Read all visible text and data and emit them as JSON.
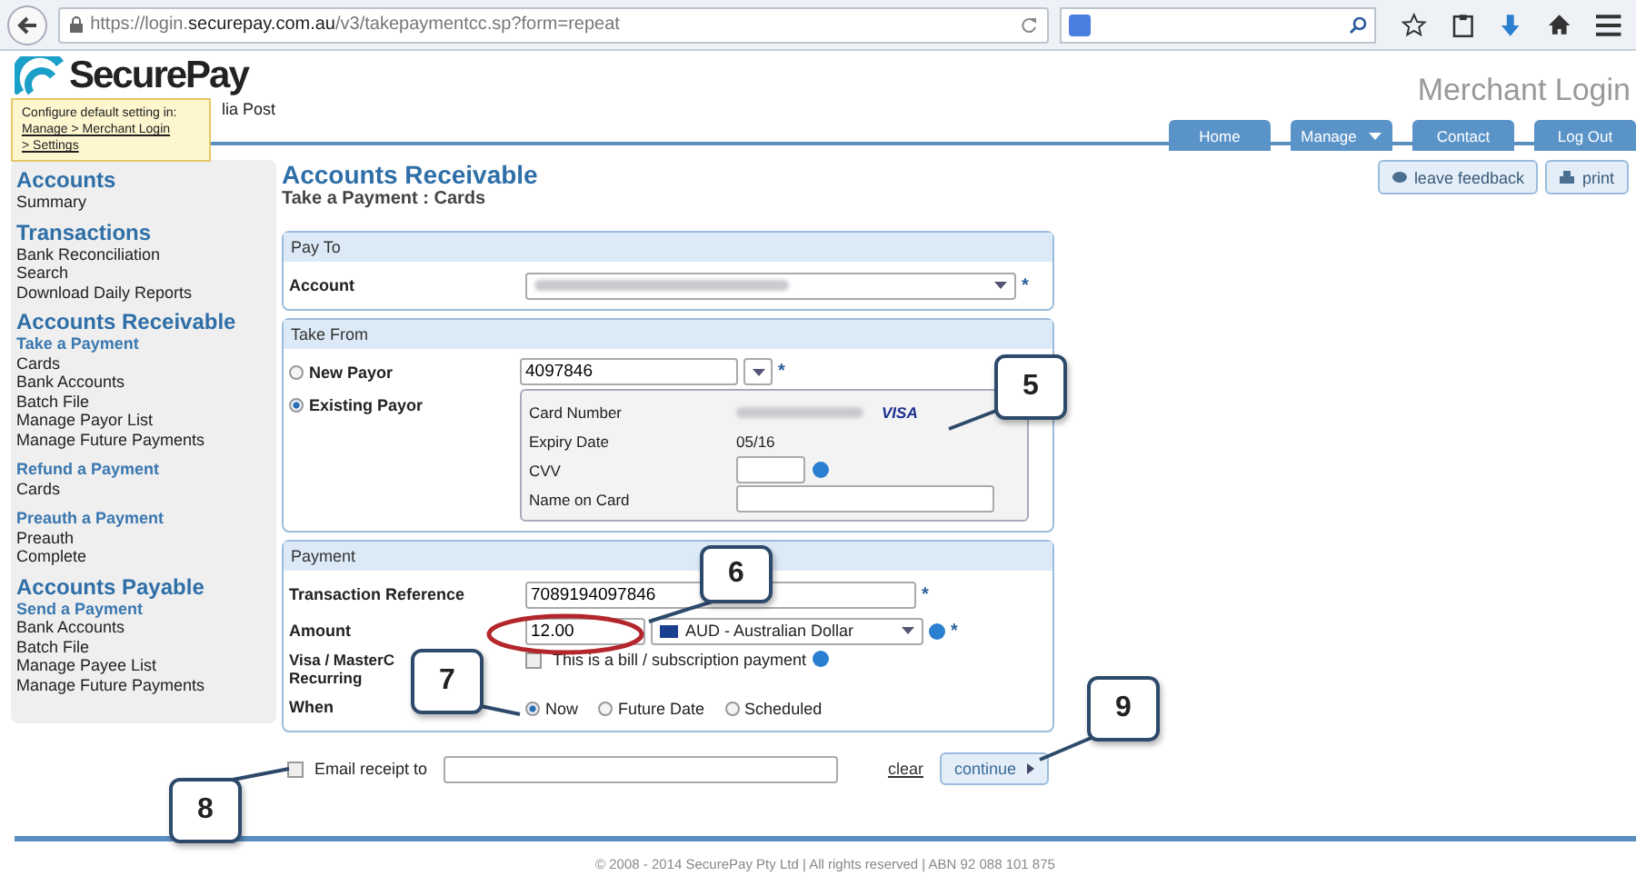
{
  "browser": {
    "url": "https://login.**securepay.com.au**/v3/takepaymentcc.sp?form=repeat"
  },
  "header": {
    "logo": "SecurePay",
    "tagline": "lia Post",
    "title": "Merchant Login",
    "tooltip": {
      "text": "Configure default setting in:",
      "links": [
        "Manage > Merchant Login",
        "> Settings"
      ]
    },
    "nav": [
      {
        "label": "Home",
        "dropdown": false
      },
      {
        "label": "Manage",
        "dropdown": true
      },
      {
        "label": "Contact",
        "dropdown": false
      },
      {
        "label": "Log Out",
        "dropdown": false
      }
    ]
  },
  "sidebar": [
    {
      "title": "Accounts",
      "items": [
        {
          "label": "Summary",
          "kind": "link"
        }
      ]
    },
    {
      "title": "Transactions",
      "items": [
        {
          "label": "Bank Reconciliation",
          "kind": "link"
        },
        {
          "label": "Search",
          "kind": "link"
        },
        {
          "label": "Download Daily Reports",
          "kind": "link"
        }
      ]
    },
    {
      "title": "Accounts Receivable",
      "items": [
        {
          "label": "Take a Payment",
          "kind": "sub"
        },
        {
          "label": "Cards",
          "kind": "link"
        },
        {
          "label": "Bank Accounts",
          "kind": "link"
        },
        {
          "label": "Batch File",
          "kind": "link"
        },
        {
          "label": "Manage Payor List",
          "kind": "link"
        },
        {
          "label": "Manage Future Payments",
          "kind": "link"
        },
        {
          "label": "Refund a Payment",
          "kind": "sub"
        },
        {
          "label": "Cards",
          "kind": "link"
        },
        {
          "label": "Preauth a Payment",
          "kind": "sub"
        },
        {
          "label": "Preauth",
          "kind": "link"
        },
        {
          "label": "Complete",
          "kind": "link"
        }
      ]
    },
    {
      "title": "Accounts Payable",
      "items": [
        {
          "label": "Send a Payment",
          "kind": "sub"
        },
        {
          "label": "Bank Accounts",
          "kind": "link"
        },
        {
          "label": "Batch File",
          "kind": "link"
        },
        {
          "label": "Manage Payee List",
          "kind": "link"
        },
        {
          "label": "Manage Future Payments",
          "kind": "link"
        }
      ]
    }
  ],
  "actions": [
    {
      "label": "leave feedback",
      "kind": "feedback"
    },
    {
      "label": "print",
      "kind": "print"
    }
  ],
  "page": {
    "title": "Accounts Receivable",
    "subtitle": "Take a Payment : Cards"
  },
  "pay_to": {
    "title": "Pay To",
    "account_label": "Account",
    "mark": "*"
  },
  "take_from": {
    "title": "Take From",
    "payor_options": [
      {
        "label": "New Payor",
        "selected": false
      },
      {
        "label": "Existing Payor",
        "selected": true
      }
    ],
    "payor_id": "4097846",
    "mark": "*",
    "card": [
      {
        "label": "Card Number",
        "kind": "masked",
        "brand": "VISA"
      },
      {
        "label": "Expiry Date",
        "kind": "text",
        "value": "05/16"
      },
      {
        "label": "CVV",
        "kind": "input",
        "help": true
      },
      {
        "label": "Name on Card",
        "kind": "wide-input",
        "help": false
      }
    ]
  },
  "payment": {
    "title": "Payment",
    "reference_label": "Transaction Reference",
    "reference": "7089194097846",
    "reference_mark": "*",
    "amount_label": "Amount",
    "amount": "12.00",
    "currency": "AUD - Australian Dollar",
    "currency_mark": "*",
    "recurring_label": [
      "Visa / MasterC",
      "Recurring"
    ],
    "recurring_checked": false,
    "recurring_text": "This is a bill / subscription payment",
    "when_label": "When",
    "when_options": [
      {
        "label": "Now",
        "selected": true
      },
      {
        "label": "Future Date",
        "selected": false
      },
      {
        "label": "Scheduled",
        "selected": false
      }
    ]
  },
  "email": {
    "checked": false,
    "label": "Email receipt to"
  },
  "clear": "clear",
  "continue": "continue",
  "footer": "© 2008 - 2014 SecurePay Pty Ltd | All rights reserved | ABN 92 088 101 875",
  "callouts": [
    "5",
    "6",
    "7",
    "8",
    "9"
  ]
}
